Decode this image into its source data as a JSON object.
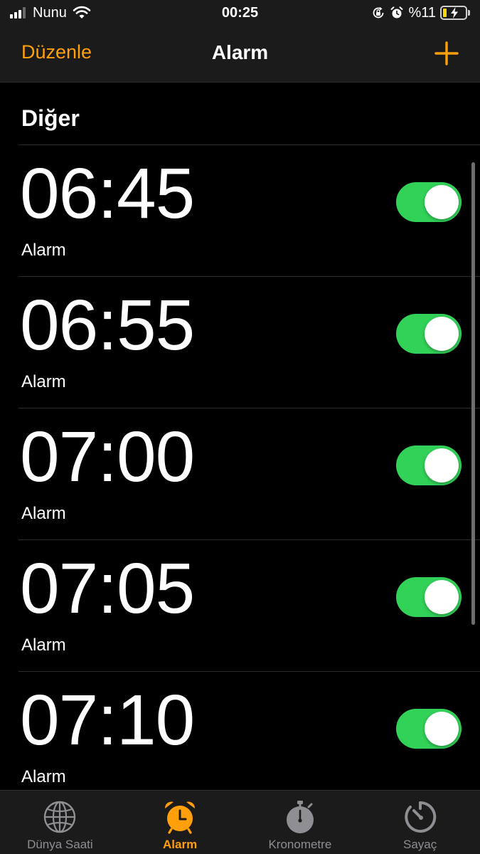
{
  "status": {
    "carrier": "Nunu",
    "time": "00:25",
    "battery_percent": "%11",
    "battery_level": 0.11,
    "signal_bars_active": 3,
    "signal_bars_total": 4,
    "icons": [
      "wifi-icon",
      "orientation-lock-icon",
      "alarm-clock-icon",
      "battery-charging-icon"
    ]
  },
  "nav": {
    "edit_label": "Düzenle",
    "title": "Alarm",
    "add_icon": "plus-icon"
  },
  "section": {
    "title": "Diğer"
  },
  "alarms": [
    {
      "time": "06:45",
      "label": "Alarm",
      "enabled": true
    },
    {
      "time": "06:55",
      "label": "Alarm",
      "enabled": true
    },
    {
      "time": "07:00",
      "label": "Alarm",
      "enabled": true
    },
    {
      "time": "07:05",
      "label": "Alarm",
      "enabled": true
    },
    {
      "time": "07:10",
      "label": "Alarm",
      "enabled": true
    }
  ],
  "tabs": [
    {
      "label": "Dünya Saati",
      "icon": "globe-icon",
      "active": false
    },
    {
      "label": "Alarm",
      "icon": "alarm-clock-icon",
      "active": true
    },
    {
      "label": "Kronometre",
      "icon": "stopwatch-icon",
      "active": false
    },
    {
      "label": "Sayaç",
      "icon": "timer-icon",
      "active": false
    }
  ],
  "colors": {
    "accent": "#ff9f0a",
    "toggle_on": "#32d158",
    "background": "#000000",
    "bar_background": "#1b1b1c",
    "inactive_tab": "#8e8e93"
  }
}
